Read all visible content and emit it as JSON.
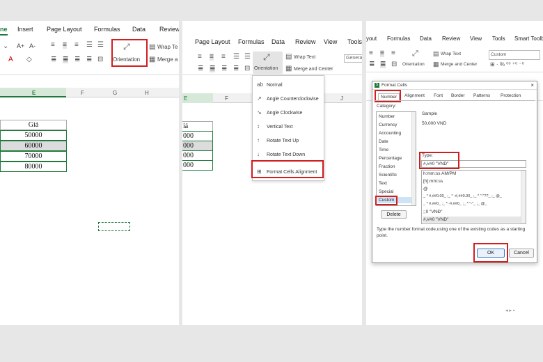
{
  "panel1": {
    "tabs": [
      "ne",
      "Insert",
      "Page Layout",
      "Formulas",
      "Data",
      "Review"
    ],
    "font_buttons": [
      "A+",
      "A-",
      "A",
      "◇"
    ],
    "orientation_label": "Orientation",
    "wrap_text_label": "Wrap Te",
    "merge_label": "Merge a",
    "columns": [
      "E",
      "F",
      "G",
      "H"
    ],
    "price_header": "Giá",
    "prices": [
      "50000",
      "60000",
      "70000",
      "80000"
    ]
  },
  "panel2": {
    "tabs": [
      "Page Layout",
      "Formulas",
      "Data",
      "Review",
      "View",
      "Tools"
    ],
    "orientation_label": "Orientation",
    "wrap_text_label": "Wrap Text",
    "merge_label": "Merge and Center",
    "general_label": "Genera",
    "columns": [
      "E",
      "F",
      "J"
    ],
    "price_header": "iá",
    "prices": [
      "000",
      "000",
      "000",
      "000"
    ],
    "menu_items": [
      {
        "icon": "ab",
        "label": "Normal"
      },
      {
        "icon": "↗",
        "label": "Angle Counterclockwise"
      },
      {
        "icon": "↘",
        "label": "Angle Clockwise"
      },
      {
        "icon": "↕",
        "label": "Vertical Text"
      },
      {
        "icon": "↑",
        "label": "Rotate Text Up"
      },
      {
        "icon": "↓",
        "label": "Rotate Text Down"
      },
      {
        "icon": "⊞",
        "label": "Format Cells Alignment"
      }
    ]
  },
  "panel3": {
    "tabs": [
      "yout",
      "Formulas",
      "Data",
      "Review",
      "View",
      "Tools",
      "Smart Toolbo"
    ],
    "orientation_label": "Orientation",
    "wrap_text_label": "Wrap Text",
    "merge_label": "Merge and Center",
    "custom_select": "Custom",
    "dialog": {
      "title": "Format Cells",
      "tabs": [
        "Number",
        "Alignment",
        "Font",
        "Border",
        "Patterns",
        "Protection"
      ],
      "category_label": "Category:",
      "categories": [
        "Number",
        "Currency",
        "Accounting",
        "Date",
        "Time",
        "Percentage",
        "Fraction",
        "Scientific",
        "Text",
        "Special",
        "Custom"
      ],
      "sample_label": "Sample",
      "sample_value": "50,000 VND",
      "type_label": "Type:",
      "type_value": "#,##0 \"VND\"",
      "formats": [
        "h:mm:ss AM/PM",
        "[h]:mm:ss",
        "@",
        "_ * #,##0.00_ ;_ * -#,##0.00_ ;_ * \"-\"??_ ;_ @_",
        "_ * #,##0_ ;_ * -#,##0_ ;_ * \"-\"_ ;_ @_",
        ";;0 \"VNĐ\"",
        "#,##0 \"VND\""
      ],
      "delete_label": "Delete",
      "description": "Type the number format code,using one of the existing codes as a starting point.",
      "ok_label": "OK",
      "cancel_label": "Cancel"
    }
  },
  "colors": {
    "accent_green": "#1e7a3c",
    "highlight_red": "#d21e1e",
    "selection_blue": "#cfe3f7"
  }
}
